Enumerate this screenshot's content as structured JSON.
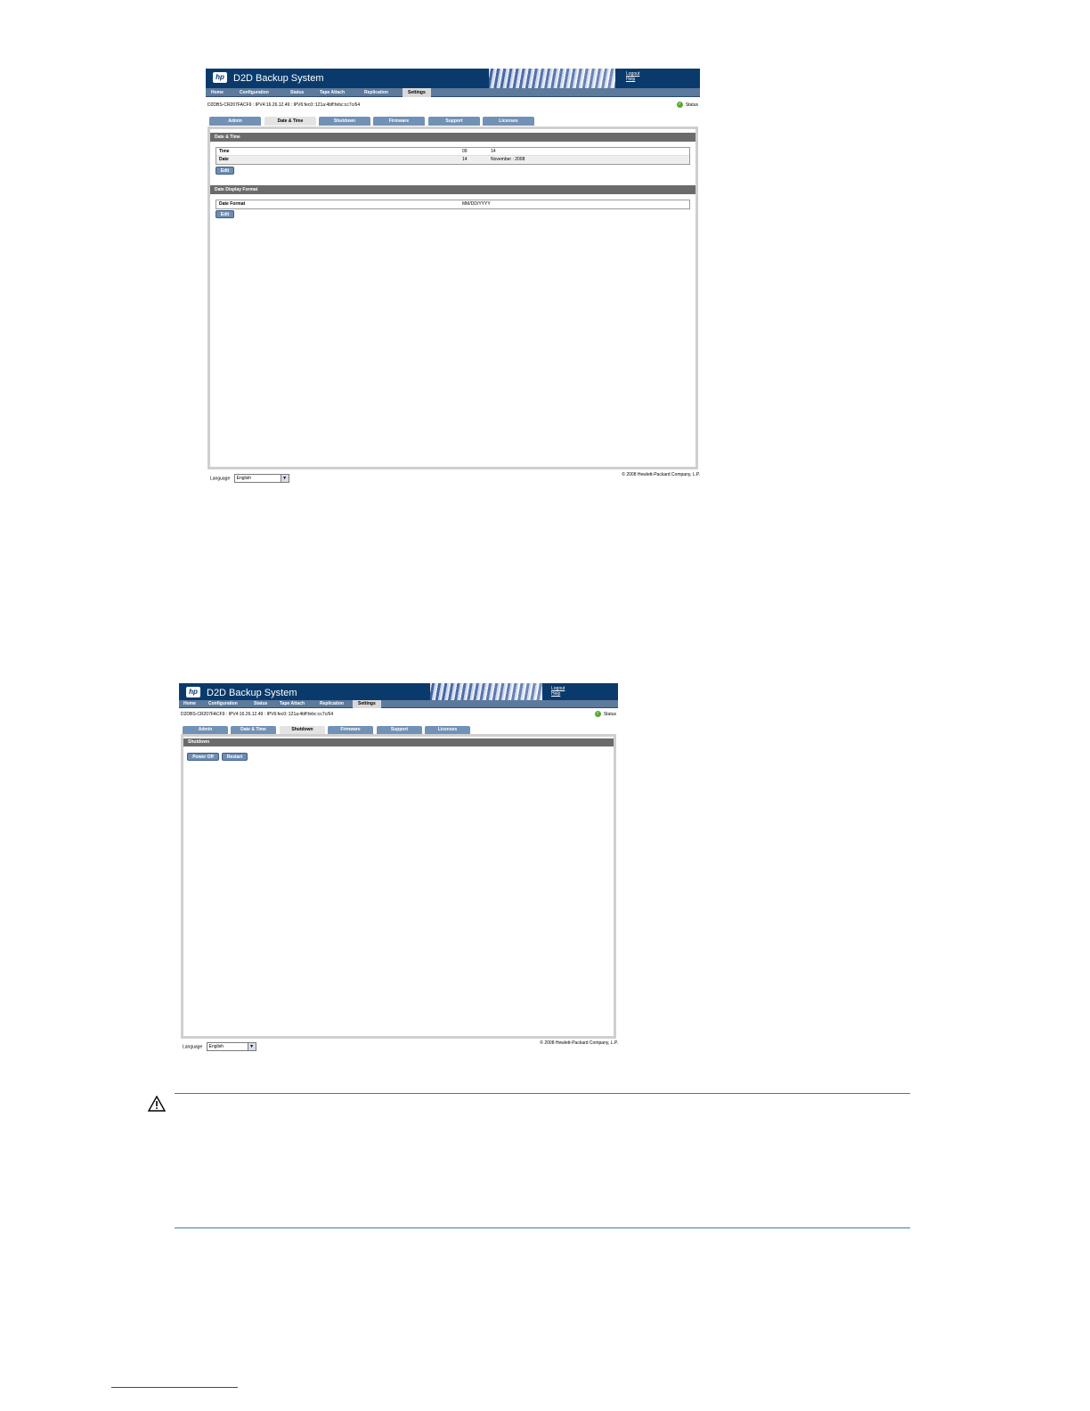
{
  "screens": [
    {
      "app_title": "D2D Backup System",
      "logo_text": "hp",
      "top_links": [
        "Logout",
        "Help"
      ],
      "nav": [
        "Home",
        "Configuration",
        "Status",
        "Tape Attach",
        "Replication",
        "Settings"
      ],
      "active_nav": "Settings",
      "host_info": "D2DBS-CR207FACF9 : IPV4:16.26.12.49 : IPV6:fec0::121a:4bff:febc:cc7c/64",
      "status_label": "Status",
      "tabs": [
        "Admin",
        "Date & Time",
        "Shutdown",
        "Firmware",
        "Support",
        "Licenses"
      ],
      "active_tab": "Date & Time",
      "sections": {
        "date_time": {
          "title": "Date & Time",
          "rows": [
            {
              "label": "Time",
              "value1": "09",
              "value2": "14"
            },
            {
              "label": "Date",
              "value1": "14",
              "value2": "November : 2008"
            }
          ],
          "edit_label": "Edit"
        },
        "date_display": {
          "title": "Date Display Format",
          "rows": [
            {
              "label": "Date Format",
              "value1": "MM/DD/YYYY"
            }
          ],
          "edit_label": "Edit"
        }
      },
      "language_label": "Language",
      "language_value": "English",
      "copyright": "© 2008 Hewlett-Packard Company, L.P."
    },
    {
      "app_title": "D2D Backup System",
      "logo_text": "hp",
      "top_links": [
        "Logout",
        "Help"
      ],
      "nav": [
        "Home",
        "Configuration",
        "Status",
        "Tape Attach",
        "Replication",
        "Settings"
      ],
      "active_nav": "Settings",
      "host_info": "D2DBS-CR207FACF9 : IPV4:16.26.12.49 : IPV6:fec0::121a:4bff:febc:cc7c/64",
      "status_label": "Status",
      "tabs": [
        "Admin",
        "Date & Time",
        "Shutdown",
        "Firmware",
        "Support",
        "Licenses"
      ],
      "active_tab": "Shutdown",
      "sections": {
        "shutdown": {
          "title": "Shutdown",
          "buttons": [
            "Power Off",
            "Restart"
          ]
        }
      },
      "language_label": "Language",
      "language_value": "English",
      "copyright": "© 2008 Hewlett-Packard Company, L.P."
    }
  ],
  "caution_icon": "warning-triangle-icon"
}
